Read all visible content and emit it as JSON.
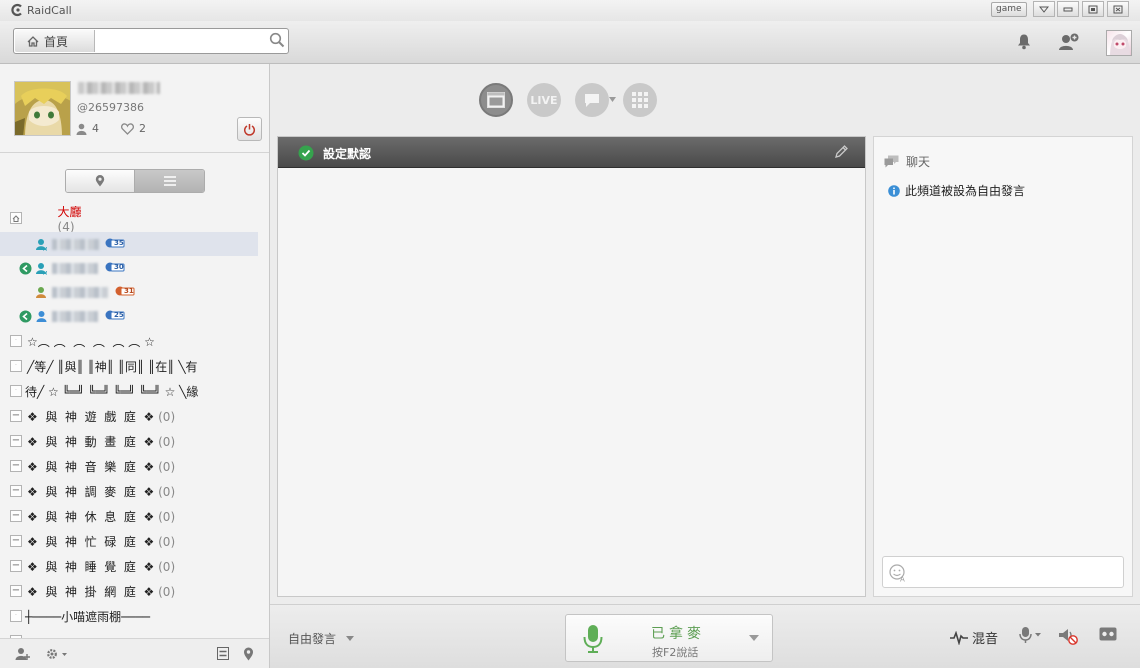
{
  "app": {
    "title": "RaidCall",
    "game_badge": "game"
  },
  "toolbar": {
    "home_label": "首頁",
    "search_value": "",
    "search_placeholder": ""
  },
  "profile": {
    "user_id": "@26597386",
    "friends_count": "4",
    "likes_count": "2"
  },
  "tree": {
    "lobby": {
      "name": "大廳",
      "count": "(4)"
    },
    "users": [
      {
        "badge": "35"
      },
      {
        "badge": "30"
      },
      {
        "badge": "31"
      },
      {
        "badge": "25"
      }
    ],
    "channels": [
      {
        "name": "☆︵ ︵  ︵  ︵  ︵ ︵ ☆",
        "count": ""
      },
      {
        "name": "╱等╱ ║與║ ║神║ ║同║ ║在║ ╲有",
        "count": ""
      },
      {
        "name": "待╱ ☆ ╚═╝ ╚═╝ ╚═╝ ╚═╝ ☆ ╲緣",
        "count": ""
      },
      {
        "name": "❖  與  神  遊  戲  庭  ❖",
        "count": "(0)"
      },
      {
        "name": "❖  與  神  動  畫  庭  ❖",
        "count": "(0)"
      },
      {
        "name": "❖  與  神  音  樂  庭  ❖",
        "count": "(0)"
      },
      {
        "name": "❖  與  神  調  麥  庭  ❖",
        "count": "(0)"
      },
      {
        "name": "❖  與  神  休  息  庭  ❖",
        "count": "(0)"
      },
      {
        "name": "❖  與  神  忙  碌  庭  ❖",
        "count": "(0)"
      },
      {
        "name": "❖  與  神  睡  覺  庭  ❖",
        "count": "(0)"
      },
      {
        "name": "❖  與  神  掛  網  庭  ❖",
        "count": "(0)"
      },
      {
        "name": "┼────小喵遮雨棚────",
        "count": ""
      }
    ]
  },
  "channel_panel": {
    "title": "設定默認"
  },
  "chat": {
    "header": "聊天",
    "messages": [
      {
        "text": "此頻道被設為自由發言"
      }
    ],
    "input_value": ""
  },
  "bottom": {
    "speak_mode": "自由發言",
    "mic_title": "已拿麥",
    "mic_hint": "按F2說話",
    "mix_label": "混音"
  },
  "colors": {
    "accent_green": "#5c9e52",
    "lobby_red": "#d10000",
    "channel_bar": "#4a4a4a"
  },
  "icons": [
    "home-icon",
    "search-icon",
    "bell-icon",
    "add-friend-icon",
    "power-icon",
    "location-icon",
    "list-icon",
    "check-icon",
    "pencil-icon",
    "chat-bubble-icon",
    "info-icon",
    "emoji-icon",
    "microphone-icon",
    "speaker-muted-icon",
    "record-icon",
    "waveform-icon"
  ]
}
